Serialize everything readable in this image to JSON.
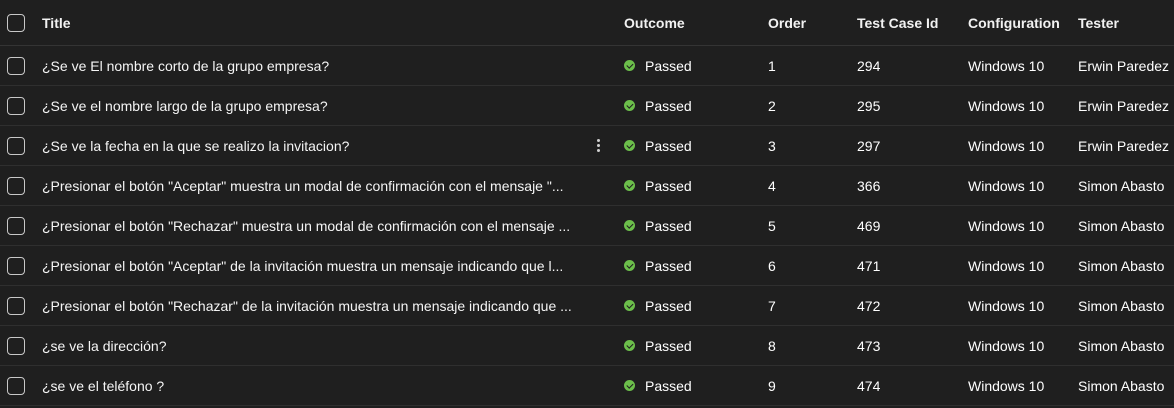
{
  "columns": {
    "title": "Title",
    "outcome": "Outcome",
    "order": "Order",
    "test_case_id": "Test Case Id",
    "configuration": "Configuration",
    "tester": "Tester"
  },
  "colors": {
    "background": "#1f1f1f",
    "passed": "#6cbf4b",
    "divider": "#2f2f2f"
  },
  "rows": [
    {
      "title": "¿Se ve El nombre corto de la grupo empresa?",
      "outcome": "Passed",
      "order": "1",
      "test_case_id": "294",
      "configuration": "Windows 10",
      "tester": "Erwin Paredez"
    },
    {
      "title": "¿Se ve el nombre largo de la grupo empresa?",
      "outcome": "Passed",
      "order": "2",
      "test_case_id": "295",
      "configuration": "Windows 10",
      "tester": "Erwin Paredez"
    },
    {
      "title": "¿Se ve la fecha en la que se realizo la invitacion?",
      "outcome": "Passed",
      "order": "3",
      "test_case_id": "297",
      "configuration": "Windows 10",
      "tester": "Erwin Paredez",
      "show_more": true
    },
    {
      "title": "¿Presionar el botón \"Aceptar\" muestra un modal de confirmación con el mensaje \"...",
      "outcome": "Passed",
      "order": "4",
      "test_case_id": "366",
      "configuration": "Windows 10",
      "tester": "Simon Abasto"
    },
    {
      "title": "¿Presionar el botón \"Rechazar\" muestra un modal de confirmación con el mensaje ...",
      "outcome": "Passed",
      "order": "5",
      "test_case_id": "469",
      "configuration": "Windows 10",
      "tester": "Simon Abasto"
    },
    {
      "title": "¿Presionar el botón \"Aceptar\" de la invitación muestra un mensaje indicando que l...",
      "outcome": "Passed",
      "order": "6",
      "test_case_id": "471",
      "configuration": "Windows 10",
      "tester": "Simon Abasto"
    },
    {
      "title": "¿Presionar el botón \"Rechazar\" de la invitación muestra un mensaje indicando que ...",
      "outcome": "Passed",
      "order": "7",
      "test_case_id": "472",
      "configuration": "Windows 10",
      "tester": "Simon Abasto"
    },
    {
      "title": "¿se ve la dirección?",
      "outcome": "Passed",
      "order": "8",
      "test_case_id": "473",
      "configuration": "Windows 10",
      "tester": "Simon Abasto"
    },
    {
      "title": "¿se ve el teléfono ?",
      "outcome": "Passed",
      "order": "9",
      "test_case_id": "474",
      "configuration": "Windows 10",
      "tester": "Simon Abasto"
    }
  ]
}
